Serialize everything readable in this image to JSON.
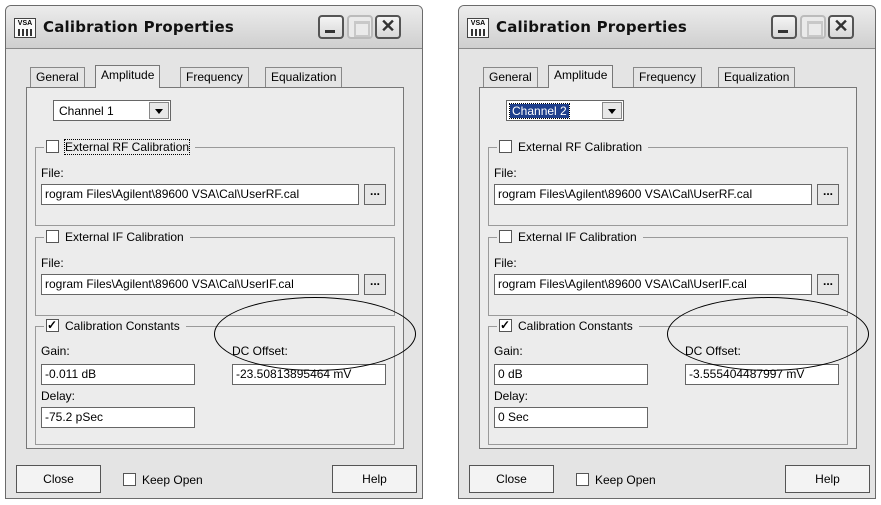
{
  "dialogs": [
    {
      "title": "Calibration Properties",
      "icon_text": "VSA",
      "tabs": [
        "General",
        "Amplitude",
        "Frequency",
        "Equalization"
      ],
      "active_tab": "Amplitude",
      "channel": "Channel 1",
      "channel_highlighted": false,
      "rf": {
        "label": "External RF Calibration",
        "checked": false,
        "file_label": "File:",
        "file_value": "rogram Files\\Agilent\\89600 VSA\\Cal\\UserRF.cal",
        "browse": "..."
      },
      "if": {
        "label": "External IF Calibration",
        "checked": false,
        "file_label": "File:",
        "file_value": "rogram Files\\Agilent\\89600 VSA\\Cal\\UserIF.cal",
        "browse": "..."
      },
      "constants": {
        "label": "Calibration Constants",
        "checked": true,
        "gain_label": "Gain:",
        "gain_value": "-0.011 dB",
        "dc_label": "DC Offset:",
        "dc_value": "-23.50813895464 mV",
        "delay_label": "Delay:",
        "delay_value": "-75.2 pSec"
      },
      "footer": {
        "close": "Close",
        "keep_open": "Keep Open",
        "keep_open_checked": false,
        "help": "Help"
      }
    },
    {
      "title": "Calibration Properties",
      "icon_text": "VSA",
      "tabs": [
        "General",
        "Amplitude",
        "Frequency",
        "Equalization"
      ],
      "active_tab": "Amplitude",
      "channel": "Channel 2",
      "channel_highlighted": true,
      "rf": {
        "label": "External RF Calibration",
        "checked": false,
        "file_label": "File:",
        "file_value": "rogram Files\\Agilent\\89600 VSA\\Cal\\UserRF.cal",
        "browse": "..."
      },
      "if": {
        "label": "External IF Calibration",
        "checked": false,
        "file_label": "File:",
        "file_value": "rogram Files\\Agilent\\89600 VSA\\Cal\\UserIF.cal",
        "browse": "..."
      },
      "constants": {
        "label": "Calibration Constants",
        "checked": true,
        "gain_label": "Gain:",
        "gain_value": "0 dB",
        "dc_label": "DC Offset:",
        "dc_value": "-3.555404487997 mV",
        "delay_label": "Delay:",
        "delay_value": "0 Sec"
      },
      "footer": {
        "close": "Close",
        "keep_open": "Keep Open",
        "keep_open_checked": false,
        "help": "Help"
      }
    }
  ]
}
